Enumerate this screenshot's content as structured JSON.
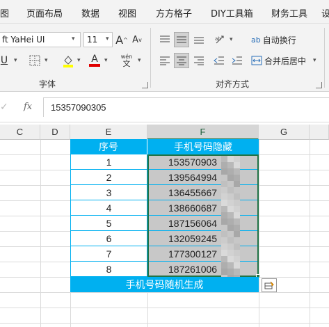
{
  "menu": [
    "图",
    "页面布局",
    "数据",
    "视图",
    "方方格子",
    "DIY工具箱",
    "财务工具",
    "设"
  ],
  "font": {
    "name": "ft YaHei UI",
    "size": "11",
    "grow_glyph": "A",
    "shrink_glyph": "A",
    "underline": "U",
    "wen_top": "wén",
    "wen_bottom": "文",
    "font_color_glyph": "A",
    "group_label": "字体"
  },
  "colors": {
    "accent_blue": "#00b0f0",
    "excel_green": "#217346",
    "highlight_yellow": "#ffff00",
    "font_red": "#e00000"
  },
  "alignment": {
    "wrap_label": "自动换行",
    "merge_label": "合并后居中",
    "group_label": "对齐方式",
    "wrap_icon_glyph": "ab"
  },
  "formula_bar": {
    "fx": "fx",
    "value": "15357090305"
  },
  "columns": [
    "C",
    "D",
    "E",
    "F",
    "G"
  ],
  "table": {
    "header_index": "序号",
    "header_phone": "手机号码隐藏",
    "rows": [
      {
        "idx": "1",
        "phone": "153570903"
      },
      {
        "idx": "2",
        "phone": "139564994"
      },
      {
        "idx": "3",
        "phone": "136455667"
      },
      {
        "idx": "4",
        "phone": "138660687"
      },
      {
        "idx": "5",
        "phone": "187156064"
      },
      {
        "idx": "6",
        "phone": "132059245"
      },
      {
        "idx": "7",
        "phone": "177300127"
      },
      {
        "idx": "8",
        "phone": "187261006"
      }
    ],
    "footer": "手机号码随机生成"
  }
}
